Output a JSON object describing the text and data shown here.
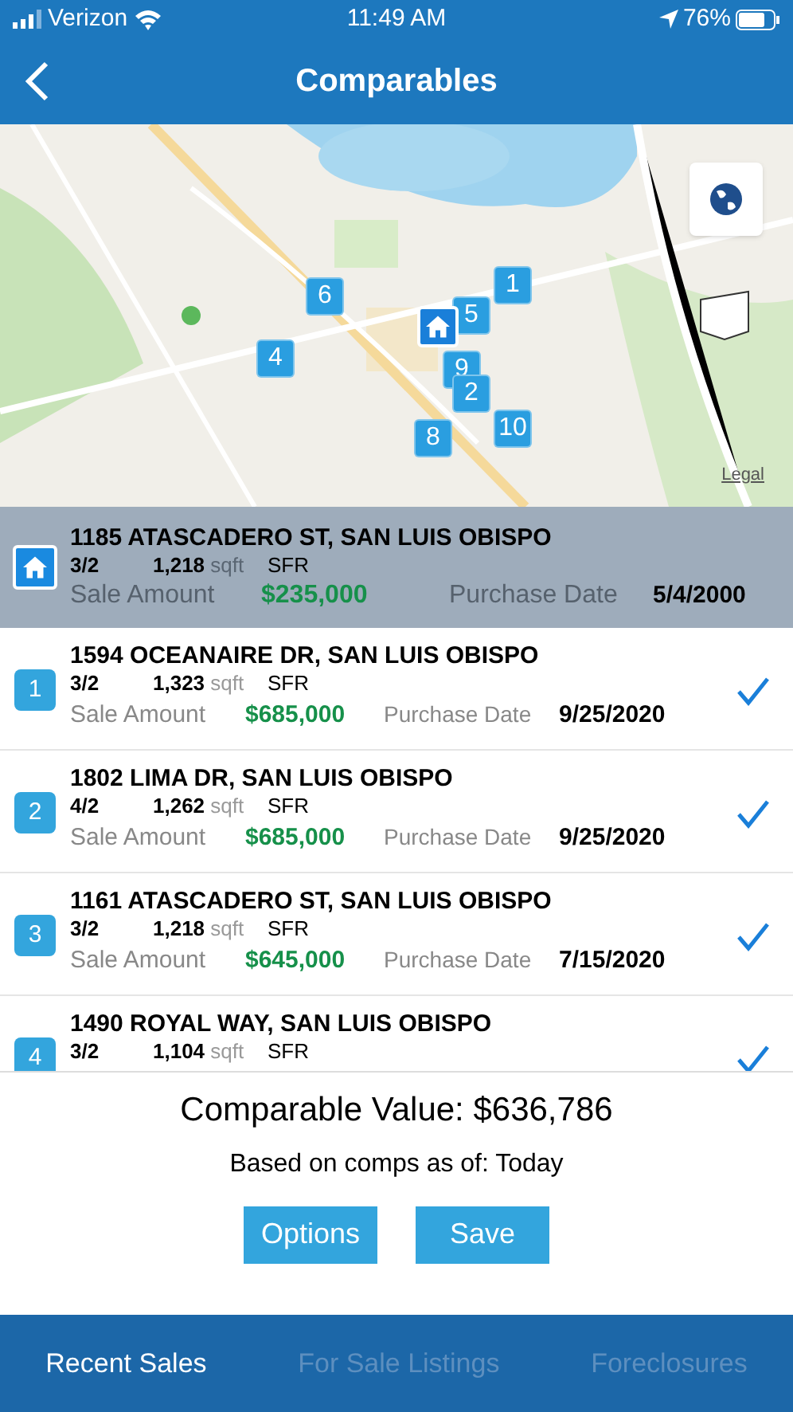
{
  "status_bar": {
    "carrier": "Verizon",
    "time": "11:49 AM",
    "battery": "76%"
  },
  "nav": {
    "title": "Comparables"
  },
  "map": {
    "pins": [
      {
        "label": "6"
      },
      {
        "label": "4"
      },
      {
        "label": "5"
      },
      {
        "label": "1"
      },
      {
        "label": "9"
      },
      {
        "label": "2"
      },
      {
        "label": "8"
      },
      {
        "label": "10"
      }
    ],
    "legal": "Legal"
  },
  "subject": {
    "address": "1185 ATASCADERO ST, SAN LUIS OBISPO",
    "beds_baths": "3/2",
    "sqft": "1,218",
    "sqft_unit": "sqft",
    "type": "SFR",
    "sale_label": "Sale Amount",
    "sale_amount": "$235,000",
    "date_label": "Purchase Date",
    "date": "5/4/2000"
  },
  "comps": [
    {
      "number": "1",
      "address": "1594 OCEANAIRE DR, SAN LUIS OBISPO",
      "beds_baths": "3/2",
      "sqft": "1,323",
      "sqft_unit": "sqft",
      "type": "SFR",
      "sale_label": "Sale Amount",
      "sale_amount": "$685,000",
      "date_label": "Purchase Date",
      "date": "9/25/2020",
      "checked": true
    },
    {
      "number": "2",
      "address": "1802 LIMA DR, SAN LUIS OBISPO",
      "beds_baths": "4/2",
      "sqft": "1,262",
      "sqft_unit": "sqft",
      "type": "SFR",
      "sale_label": "Sale Amount",
      "sale_amount": "$685,000",
      "date_label": "Purchase Date",
      "date": "9/25/2020",
      "checked": true
    },
    {
      "number": "3",
      "address": "1161 ATASCADERO ST, SAN LUIS OBISPO",
      "beds_baths": "3/2",
      "sqft": "1,218",
      "sqft_unit": "sqft",
      "type": "SFR",
      "sale_label": "Sale Amount",
      "sale_amount": "$645,000",
      "date_label": "Purchase Date",
      "date": "7/15/2020",
      "checked": true
    },
    {
      "number": "4",
      "address": "1490 ROYAL WAY, SAN LUIS OBISPO",
      "beds_baths": "3/2",
      "sqft": "1,104",
      "sqft_unit": "sqft",
      "type": "SFR",
      "checked": true
    }
  ],
  "summary": {
    "value": "Comparable Value: $636,786",
    "basis": "Based on comps as of: Today"
  },
  "buttons": [
    {
      "label": "Options"
    },
    {
      "label": "Save"
    }
  ],
  "tabs": [
    {
      "label": "Recent Sales",
      "selected": true
    },
    {
      "label": "For Sale Listings",
      "selected": false
    },
    {
      "label": "Foreclosures",
      "selected": false
    }
  ]
}
